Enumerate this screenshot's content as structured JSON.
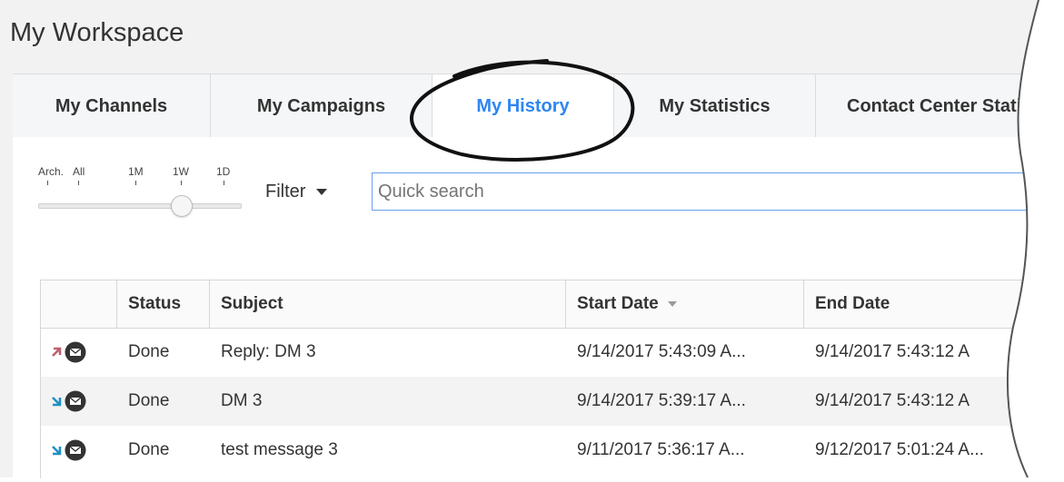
{
  "workspace": {
    "title": "My Workspace"
  },
  "tabs": [
    {
      "label": "My Channels"
    },
    {
      "label": "My Campaigns"
    },
    {
      "label": "My History",
      "active": true
    },
    {
      "label": "My Statistics"
    },
    {
      "label": "Contact Center Stati"
    }
  ],
  "range": {
    "labels": [
      "Arch.",
      "All",
      "1M",
      "1W",
      "1D"
    ],
    "selected": "1W"
  },
  "filter": {
    "label": "Filter"
  },
  "search": {
    "placeholder": "Quick search"
  },
  "table": {
    "columns": [
      "Status",
      "Subject",
      "Start Date",
      "End Date"
    ],
    "sort_column": "Start Date",
    "rows": [
      {
        "direction": "outbound",
        "status": "Done",
        "subject": "Reply: DM 3",
        "start": "9/14/2017 5:43:09 A...",
        "end": "9/14/2017 5:43:12 A"
      },
      {
        "direction": "inbound",
        "status": "Done",
        "subject": "DM 3",
        "start": "9/14/2017 5:39:17 A...",
        "end": "9/14/2017 5:43:12 A"
      },
      {
        "direction": "inbound",
        "status": "Done",
        "subject": "test message 3",
        "start": "9/11/2017 5:36:17 A...",
        "end": "9/12/2017 5:01:24 A..."
      }
    ]
  },
  "colors": {
    "accent": "#2e86f0",
    "outbound": "#c0606e",
    "inbound": "#1e8fc7",
    "mail": "#333333"
  },
  "icons": {
    "outbound": "arrow-outbound-icon",
    "inbound": "arrow-inbound-icon",
    "channel": "email-channel-icon"
  }
}
